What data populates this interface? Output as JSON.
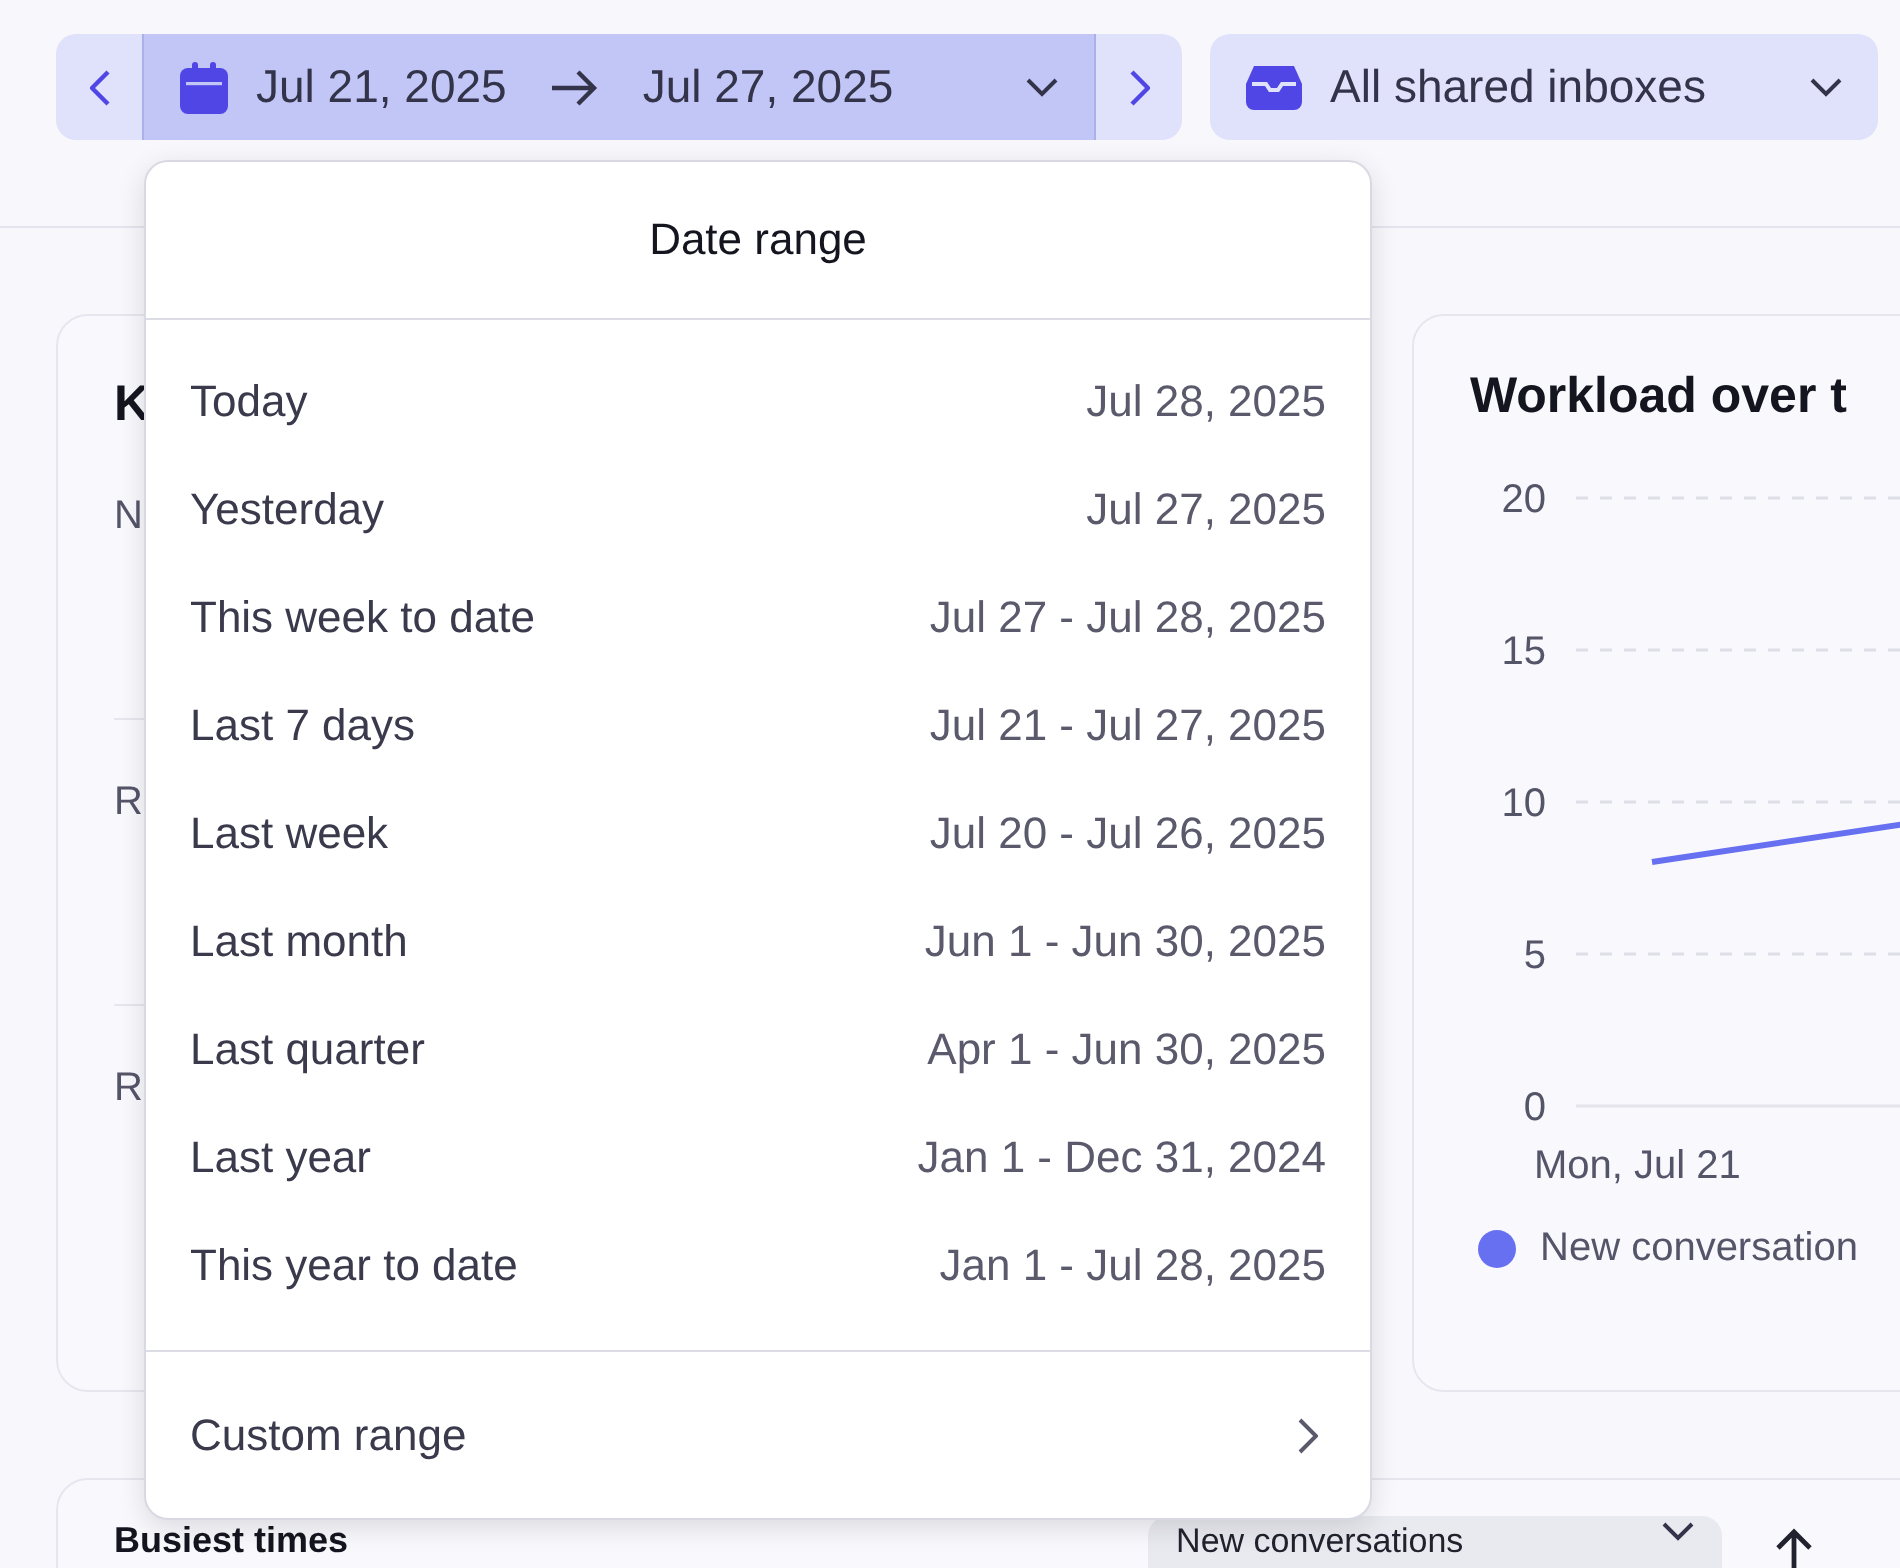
{
  "toolbar": {
    "date_range": {
      "start": "Jul 21, 2025",
      "end": "Jul 27, 2025"
    },
    "inbox_filter": {
      "label": "All shared inboxes"
    }
  },
  "kpi_card": {
    "title": "K",
    "metrics": [
      {
        "label": "N"
      },
      {
        "label": "R"
      },
      {
        "label": "R"
      }
    ]
  },
  "workload_card": {
    "title": "Workload over t",
    "y_axis_labels": [
      "20",
      "15",
      "10",
      "5",
      "0"
    ],
    "x_axis_labels": [
      "Mon, Jul 21"
    ],
    "legend": [
      {
        "label": "New conversation",
        "color": "#6670f0"
      }
    ]
  },
  "busiest_card": {
    "title": "Busiest times",
    "metric_select": {
      "value": "New conversations"
    }
  },
  "date_range_menu": {
    "title": "Date range",
    "options": [
      {
        "label": "Today",
        "range": "Jul 28, 2025"
      },
      {
        "label": "Yesterday",
        "range": "Jul 27, 2025"
      },
      {
        "label": "This week to date",
        "range": "Jul 27 - Jul 28, 2025"
      },
      {
        "label": "Last 7 days",
        "range": "Jul 21 - Jul 27, 2025"
      },
      {
        "label": "Last week",
        "range": "Jul 20 - Jul 26, 2025"
      },
      {
        "label": "Last month",
        "range": "Jun 1 - Jun 30, 2025"
      },
      {
        "label": "Last quarter",
        "range": "Apr 1 - Jun 30, 2025"
      },
      {
        "label": "Last year",
        "range": "Jan 1 - Dec 31, 2024"
      },
      {
        "label": "This year to date",
        "range": "Jan 1 - Jul 28, 2025"
      }
    ],
    "custom_option": {
      "label": "Custom range"
    }
  }
}
